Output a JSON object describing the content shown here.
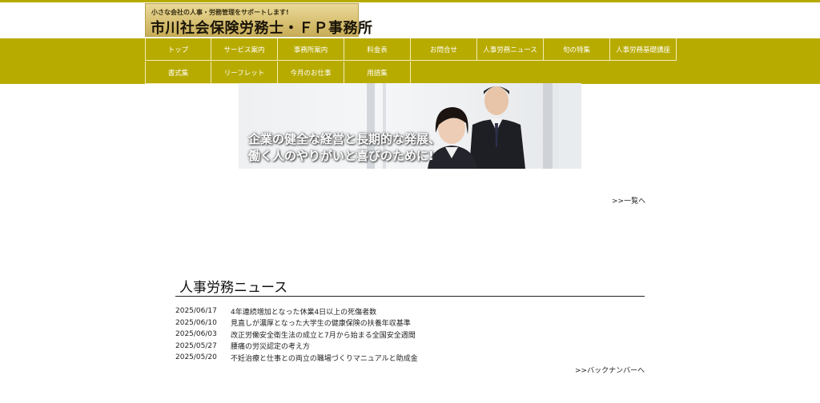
{
  "logo": {
    "tagline": "小さな会社の人事・労務管理をサポートします!",
    "name": "市川社会保険労務士・ＦＰ事務所"
  },
  "nav": {
    "row1": [
      "トップ",
      "サービス案内",
      "事務所案内",
      "料金表",
      "お問合せ",
      "人事労務ニュース",
      "旬の特集",
      "人事労務基礎講座"
    ],
    "row2": [
      "書式集",
      "リーフレット",
      "今月のお仕事",
      "用語集"
    ]
  },
  "hero": {
    "line1": "企業の健全な経営と長期的な発展、",
    "line2": "働く人のやりがいと喜びのために!"
  },
  "top_more_link": ">>一覧へ",
  "news": {
    "title": "人事労務ニュース",
    "items": [
      {
        "date": "2025/06/17",
        "title": "4年連続増加となった休業4日以上の死傷者数"
      },
      {
        "date": "2025/06/10",
        "title": "見直しが濃厚となった大学生の健康保険の扶養年収基準"
      },
      {
        "date": "2025/06/03",
        "title": "改正労働安全衛生法の成立と7月から始まる全国安全週間"
      },
      {
        "date": "2025/05/27",
        "title": "腰痛の労災認定の考え方"
      },
      {
        "date": "2025/05/20",
        "title": "不妊治療と仕事との両立の職場づくりマニュアルと助成金"
      }
    ],
    "backnumber": ">>バックナンバーへ"
  },
  "colors": {
    "nav_bg": "#b8ab00",
    "nav_border": "#f2eeb8",
    "logo_gold": "#d8c173"
  }
}
